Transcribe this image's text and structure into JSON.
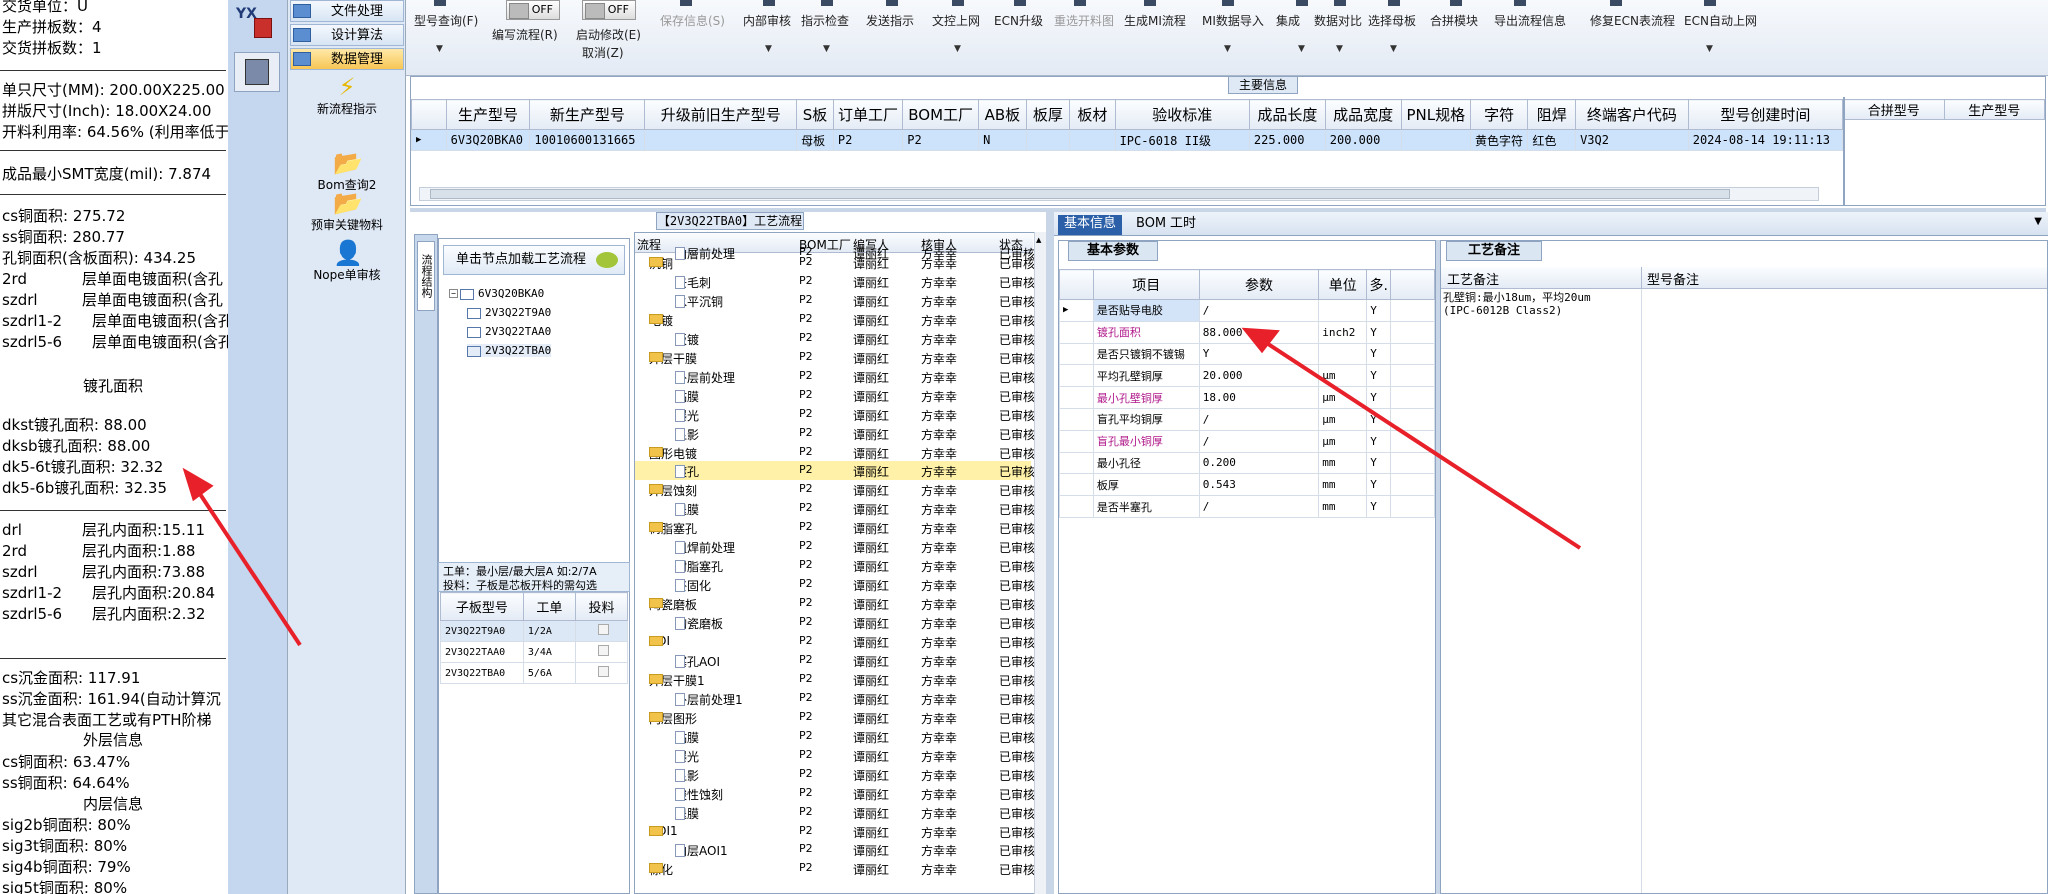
{
  "left_panel": {
    "lines_top": [
      "交货单位：U",
      "生产拼板数：4",
      "交货拼板数：1"
    ],
    "size_lines": [
      "单只尺寸(MM): 200.00X225.00",
      "拼版尺寸(Inch): 18.00X24.00",
      "开料利用率: 64.56% (利用率低于"
    ],
    "smt": "成品最小SMT宽度(mil): 7.874",
    "copper_area": [
      "cs铜面积: 275.72",
      "ss铜面积: 280.77",
      "孔铜面积(含板面积): 434.25"
    ],
    "layer_plating": [
      {
        "k": "2rd",
        "v": "层单面电镀面积(含孔"
      },
      {
        "k": "szdrl",
        "v": "层单面电镀面积(含孔"
      },
      {
        "k": "szdrl1-2",
        "v": "层单面电镀面积(含孔"
      },
      {
        "k": "szdrl5-6",
        "v": "层单面电镀面积(含孔"
      }
    ],
    "hole_plating_title": "镀孔面积",
    "hole_plating": [
      "dkst镀孔面积: 88.00",
      "dksb镀孔面积: 88.00",
      "dk5-6t镀孔面积: 32.32",
      "dk5-6b镀孔面积: 32.35"
    ],
    "inner_hole": [
      {
        "k": "drl",
        "v": "层孔内面积:15.11"
      },
      {
        "k": "2rd",
        "v": "层孔内面积:1.88"
      },
      {
        "k": "szdrl",
        "v": "层孔内面积:73.88"
      },
      {
        "k": "szdrl1-2",
        "v": "层孔内面积:20.84"
      },
      {
        "k": "szdrl5-6",
        "v": "层孔内面积:2.32"
      }
    ],
    "gold": [
      "cs沉金面积: 117.91",
      "ss沉金面积: 161.94(自动计算沉",
      "其它混合表面工艺或有PTH阶梯"
    ],
    "outer_title": "外层信息",
    "outer": [
      "cs铜面积: 63.47%",
      "ss铜面积: 64.64%"
    ],
    "inner_title": "内层信息",
    "inner": [
      "sig2b铜面积: 80%",
      "sig3t铜面积: 80%",
      "sig4b铜面积: 79%",
      "sig5t铜面积: 80%"
    ]
  },
  "nav": {
    "logo": "YX",
    "menu": [
      {
        "label": "文件处理"
      },
      {
        "label": "设计算法"
      },
      {
        "label": "数据管理"
      }
    ],
    "tools": [
      {
        "label": "新流程指示",
        "icon": "lightning-icon"
      },
      {
        "label": "Bom查询2",
        "icon": "folder-icon"
      },
      {
        "label": "预审关键物料",
        "icon": "folder-icon"
      },
      {
        "label": "Nope单审核",
        "icon": "user-icon"
      }
    ]
  },
  "toolbar": {
    "items": [
      {
        "label": "型号查询(F)",
        "caret": true
      },
      {
        "label": "编写流程(R)",
        "toggle": "OFF"
      },
      {
        "label": "启动修改(E)",
        "toggle": "OFF",
        "sub": "取消(Z)"
      },
      {
        "label": "保存信息(S)",
        "disabled": true
      },
      {
        "label": "内部审核",
        "caret": true
      },
      {
        "label": "指示检查",
        "caret": true
      },
      {
        "label": "发送指示"
      },
      {
        "label": "文控上网",
        "caret": true
      },
      {
        "label": "ECN升级"
      },
      {
        "label": "重选开料图",
        "disabled": true
      },
      {
        "label": "生成MI流程"
      },
      {
        "label": "MI数据导入",
        "caret": true
      },
      {
        "label": "集成",
        "caret": true
      },
      {
        "label": "数据对比",
        "caret": true
      },
      {
        "label": "选择母板",
        "caret": true
      },
      {
        "label": "合拼模块"
      },
      {
        "label": "导出流程信息"
      },
      {
        "label": "修复ECN表流程"
      },
      {
        "label": "ECN自动上网",
        "caret": true
      }
    ]
  },
  "main_info": {
    "title": "主要信息",
    "headers": [
      "生产型号",
      "新生产型号",
      "升级前旧生产型号",
      "S板",
      "订单工厂",
      "BOM工厂",
      "AB板",
      "板厚",
      "板材",
      "验收标准",
      "成品长度",
      "成品宽度",
      "PNL规格",
      "字符",
      "阻焊",
      "终端客户代码",
      "型号创建时间"
    ],
    "row": [
      "6V3Q20BKA0",
      "10010600131665",
      "",
      "母板",
      "P2",
      "P2",
      "N",
      "",
      "",
      "IPC-6018 II级",
      "225.000",
      "200.000",
      "",
      "黄色字符",
      "红色",
      "V3Q2",
      "2024-08-14 19:11:13"
    ],
    "merge_headers": [
      "合拼型号",
      "生产型号"
    ]
  },
  "tree": {
    "title": "【2V3Q22TBA0】工艺流程",
    "side_tab": "流程结构",
    "load_button": "单击节点加载工艺流程",
    "nodes": [
      "6V3Q20BKA0",
      "2V3Q22T9A0",
      "2V3Q22TAA0",
      "2V3Q22TBA0"
    ],
    "note_lines": [
      "工单：最小层/最大层A 如:2/7A",
      "投料：子板是芯板开料的需勾选"
    ],
    "sub_headers": [
      "子板型号",
      "工单",
      "投料"
    ],
    "sub_rows": [
      {
        "model": "2V3Q22T9A0",
        "order": "1/2A"
      },
      {
        "model": "2V3Q22TAA0",
        "order": "3/4A"
      },
      {
        "model": "2V3Q22TBA0",
        "order": "5/6A"
      }
    ]
  },
  "process": {
    "headers": [
      "流程",
      "BOM工厂",
      "编写人",
      "核审人",
      "状态"
    ],
    "writer": "谭丽红",
    "reviewer": "方幸幸",
    "factory": "P2",
    "status": "已审核",
    "rows": [
      {
        "name": "内層前处理",
        "level": 1
      },
      {
        "name": "沉铜",
        "level": 0
      },
      {
        "name": "去毛刺",
        "level": 1
      },
      {
        "name": "水平沉铜",
        "level": 1
      },
      {
        "name": "电镀",
        "level": 0
      },
      {
        "name": "板镀",
        "level": 1
      },
      {
        "name": "外层干膜",
        "level": 0
      },
      {
        "name": "外层前处理",
        "level": 1
      },
      {
        "name": "贴膜",
        "level": 1
      },
      {
        "name": "曝光",
        "level": 1
      },
      {
        "name": "显影",
        "level": 1
      },
      {
        "name": "图形电镀",
        "level": 0
      },
      {
        "name": "镀孔",
        "level": 1,
        "hl": true
      },
      {
        "name": "外层蚀刻",
        "level": 0
      },
      {
        "name": "退膜",
        "level": 1
      },
      {
        "name": "树脂塞孔",
        "level": 0
      },
      {
        "name": "阻焊前处理",
        "level": 1
      },
      {
        "name": "树脂塞孔",
        "level": 1
      },
      {
        "name": "终固化",
        "level": 1
      },
      {
        "name": "陶瓷磨板",
        "level": 0
      },
      {
        "name": "陶瓷磨板",
        "level": 1
      },
      {
        "name": "AOI",
        "level": 0
      },
      {
        "name": "塞孔AOI",
        "level": 1
      },
      {
        "name": "外层干膜1",
        "level": 0
      },
      {
        "name": "外层前处理1",
        "level": 1
      },
      {
        "name": "内层图形",
        "level": 0
      },
      {
        "name": "贴膜",
        "level": 1
      },
      {
        "name": "曝光",
        "level": 1
      },
      {
        "name": "显影",
        "level": 1
      },
      {
        "name": "酸性蚀刻",
        "level": 1
      },
      {
        "name": "退膜",
        "level": 1
      },
      {
        "name": "AOI1",
        "level": 0
      },
      {
        "name": "内层AOI1",
        "level": 1
      },
      {
        "name": "棕化",
        "level": 0
      }
    ]
  },
  "detail": {
    "tabs": [
      "基本信息",
      "BOM",
      "工时"
    ],
    "basic_title": "基本参数",
    "headers": [
      "项目",
      "参数",
      "单位",
      "多."
    ],
    "rows": [
      {
        "item": "是否贴导电胶",
        "value": "/",
        "unit": "",
        "flag": "Y",
        "style": ""
      },
      {
        "item": "镀孔面积",
        "value": "88.000",
        "unit": "inch2",
        "flag": "Y",
        "style": "mag"
      },
      {
        "item": "是否只镀铜不镀锡",
        "value": "Y",
        "unit": "",
        "flag": "Y",
        "style": ""
      },
      {
        "item": "平均孔壁铜厚",
        "value": "20.000",
        "unit": "μm",
        "flag": "Y",
        "style": ""
      },
      {
        "item": "最小孔壁铜厚",
        "value": "18.00",
        "unit": "μm",
        "flag": "Y",
        "style": "mag"
      },
      {
        "item": "盲孔平均铜厚",
        "value": "/",
        "unit": "μm",
        "flag": "Y",
        "style": ""
      },
      {
        "item": "盲孔最小铜厚",
        "value": "/",
        "unit": "μm",
        "flag": "Y",
        "style": "mag"
      },
      {
        "item": "最小孔径",
        "value": "0.200",
        "unit": "mm",
        "flag": "Y",
        "style": ""
      },
      {
        "item": "板厚",
        "value": "0.543",
        "unit": "mm",
        "flag": "Y",
        "style": ""
      },
      {
        "item": "是否半塞孔",
        "value": "/",
        "unit": "mm",
        "flag": "Y",
        "style": ""
      }
    ],
    "note_title": "工艺备注",
    "note_headers": [
      "工艺备注",
      "型号备注"
    ],
    "note_text": [
      "孔壁铜:最小18um，平均20um",
      "(IPC-6012B Class2)"
    ]
  }
}
